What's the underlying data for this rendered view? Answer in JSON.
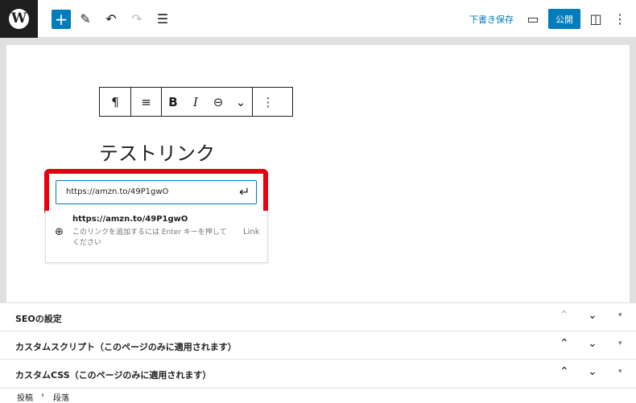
{
  "toolbar": {
    "logo": "W",
    "add_icon": "+",
    "tools_icon": "✎",
    "undo_icon": "↶",
    "redo_icon": "↷",
    "list_view_icon": "☰",
    "save_draft": "下書き保存",
    "view_icon": "▭",
    "publish": "公開",
    "settings_icon": "◫",
    "options_icon": "⋮"
  },
  "block_toolbar": {
    "paragraph_icon": "¶",
    "align_icon": "≡",
    "bold": "B",
    "italic": "I",
    "link_icon": "⊖",
    "more_icon": "⌄",
    "options_icon": "⋮"
  },
  "editor": {
    "heading": "テストリンク"
  },
  "link_popover": {
    "input_value": "https://amzn.to/49P1gwO",
    "submit_icon": "↵",
    "suggestion_title": "https://amzn.to/49P1gwO",
    "suggestion_desc": "このリンクを追加するには Enter キーを押してください",
    "suggestion_type": "Link",
    "globe_icon": "⊕"
  },
  "meta_panels": [
    {
      "label": "SEOの設定",
      "up": "⌃",
      "down": "⌄",
      "toggle": "▾"
    },
    {
      "label": "カスタムスクリプト（このページのみに適用されます）",
      "up": "⌃",
      "down": "⌄",
      "toggle": "▾"
    },
    {
      "label": "カスタムCSS（このページのみに適用されます）",
      "up": "⌃",
      "down": "⌄",
      "toggle": "▾"
    }
  ],
  "breadcrumbs": {
    "item1": "投稿",
    "separator": "›",
    "item2": "段落"
  },
  "colors": {
    "accent": "#007cba",
    "highlight": "#e60012"
  }
}
